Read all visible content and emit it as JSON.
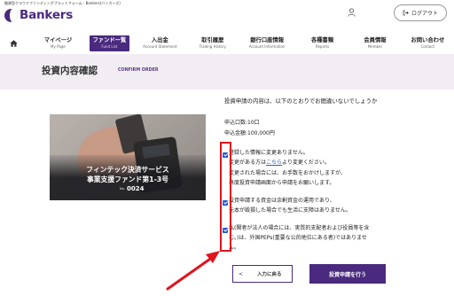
{
  "header": {
    "tagline": "融資型クラウドファンディングプラットフォーム - Bankers(バンカーズ)",
    "logo_text": "Bankers",
    "login_label": "ログアウト"
  },
  "nav": {
    "home_icon": "home-icon",
    "items": [
      {
        "jp": "マイページ",
        "en": "My Page",
        "active": false
      },
      {
        "jp": "ファンド一覧",
        "en": "Fund List",
        "active": true
      },
      {
        "jp": "入出金",
        "en": "Account Statement",
        "active": false
      },
      {
        "jp": "取引履歴",
        "en": "Trading History",
        "active": false
      },
      {
        "jp": "銀行口座情報",
        "en": "Account Information",
        "active": false
      },
      {
        "jp": "各種書類",
        "en": "Reports",
        "active": false
      },
      {
        "jp": "会員情報",
        "en": "Member",
        "active": false
      },
      {
        "jp": "お問い合わせ",
        "en": "Contact",
        "active": false
      }
    ]
  },
  "page": {
    "title": "投資内容確認",
    "subtitle": "CONFIRM ORDER"
  },
  "fund": {
    "line1": "フィンテック決済サービス",
    "line2": "事業支援ファンド第1-3号",
    "no_label": "No.",
    "number": "0024"
  },
  "confirm": {
    "intro": "投資申請の内容は、以下のとおりでお間違いないでしょうか",
    "units": "申込口数:10口",
    "amount": "申込金額:100,000円",
    "check1_l1": "登録した情報に変更ありません。",
    "check1_l2a": "変更がある方は",
    "check1_link": "こちら",
    "check1_l2b": "より変更ください。",
    "check1_l3": "変更された場合には、お手数をおかけしますが、",
    "check1_l4": "再度投資申請画面から申請をお願いします。",
    "check2_l1": "投資申請する資金は余剰資金の運用であり、",
    "check2_l2": "元本が毀損した場合でも生活に支障はありません。",
    "check3_l1": "私(関者が法人の場合には、実質的支配者および役員等を含",
    "check3_l2": "む。)は、外国PEPs(重要な公的地位にある者)ではありませ",
    "check3_l3": "ん。"
  },
  "buttons": {
    "back_arrow": "<",
    "back": "入力に戻る",
    "submit": "投資申請を行う"
  },
  "colors": {
    "brand": "#4a2a7e",
    "band": "#f1edf2",
    "checkbox": "#1a56d6",
    "annotation": "#e0141e"
  }
}
